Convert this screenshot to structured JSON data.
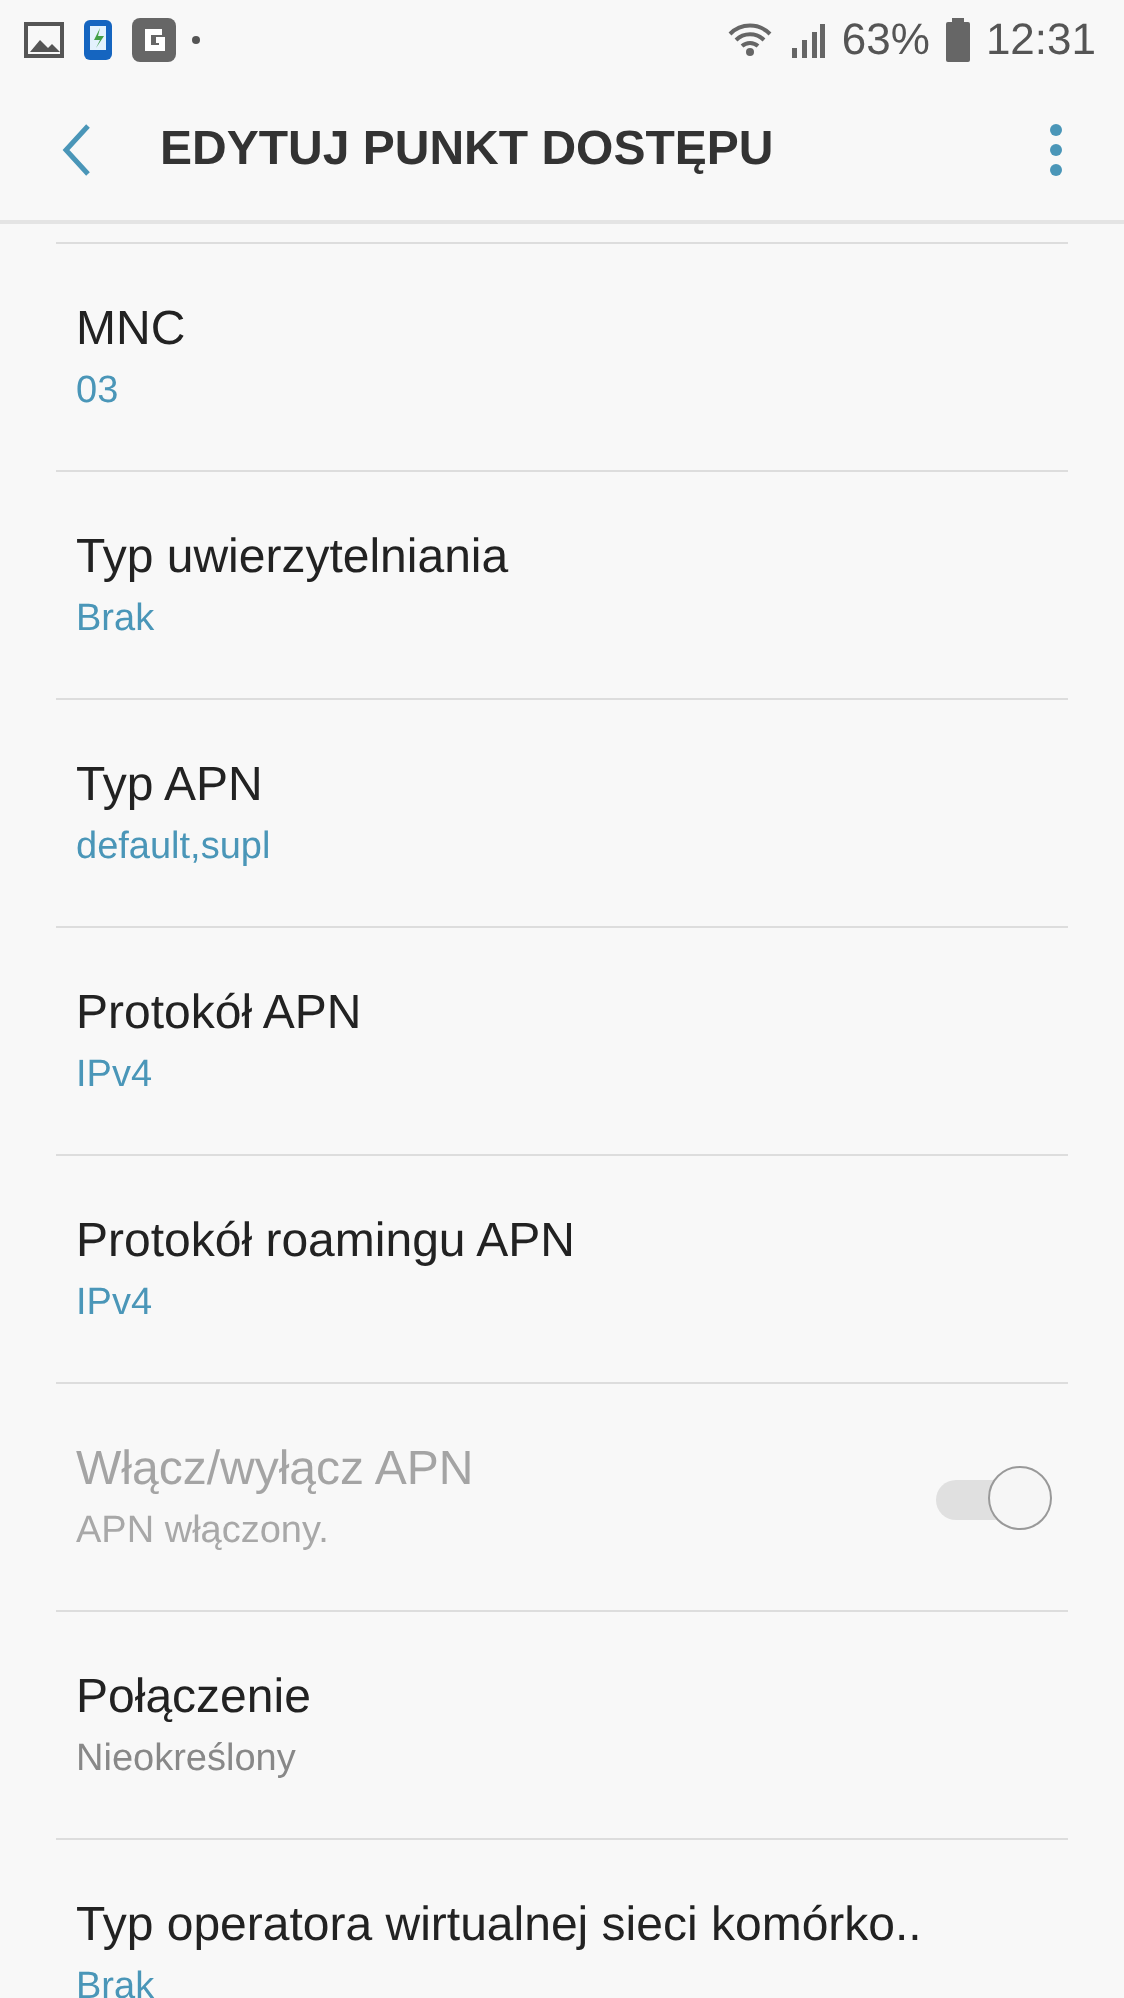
{
  "status_bar": {
    "battery": "63%",
    "time": "12:31"
  },
  "app_bar": {
    "title": "EDYTUJ PUNKT DOSTĘPU"
  },
  "items": [
    {
      "kind": "text",
      "title": "MNC",
      "value": "03",
      "highlighted": true,
      "disabled": false
    },
    {
      "kind": "text",
      "title": "Typ uwierzytelniania",
      "value": "Brak",
      "highlighted": true,
      "disabled": false
    },
    {
      "kind": "text",
      "title": "Typ APN",
      "value": "default,supl",
      "highlighted": true,
      "disabled": false
    },
    {
      "kind": "text",
      "title": "Protokół APN",
      "value": "IPv4",
      "highlighted": true,
      "disabled": false
    },
    {
      "kind": "text",
      "title": "Protokół roamingu APN",
      "value": "IPv4",
      "highlighted": true,
      "disabled": false
    },
    {
      "kind": "toggle",
      "title": "Włącz/wyłącz APN",
      "value": "APN włączony.",
      "highlighted": false,
      "disabled": true,
      "on": true
    },
    {
      "kind": "text",
      "title": "Połączenie",
      "value": "Nieokreślony",
      "highlighted": false,
      "disabled": false
    },
    {
      "kind": "text",
      "title": "Typ operatora wirtualnej sieci komórko..",
      "value": "Brak",
      "highlighted": true,
      "disabled": false
    }
  ]
}
